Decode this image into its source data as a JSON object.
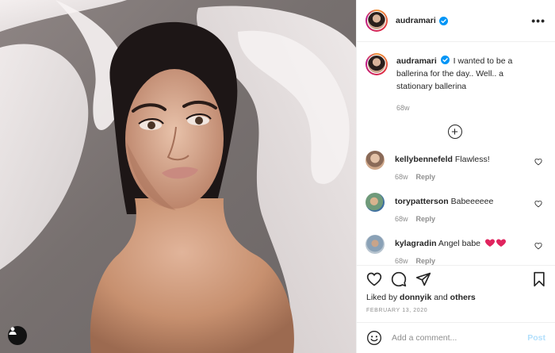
{
  "post": {
    "username": "audramari",
    "verified": true,
    "more_icon": "more-horizontal-icon",
    "caption": {
      "username": "audramari",
      "text": "I wanted to be a ballerina for the day.. Well.. a stationary ballerina",
      "timestamp": "68w"
    },
    "load_more_icon": "plus-circle-icon",
    "comments": [
      {
        "username": "kellybennefeld",
        "text": "Flawless!",
        "timestamp": "68w",
        "reply": "Reply",
        "avatar_color": "#cfa88b"
      },
      {
        "username": "torypatterson",
        "text": "Babeeeeee",
        "timestamp": "68w",
        "reply": "Reply",
        "avatar_color": "#6f9a7a"
      },
      {
        "username": "kylagradin",
        "text": "Angel babe",
        "emoji": "two-hearts",
        "timestamp": "68w",
        "reply": "Reply",
        "avatar_color": "#8aa1b6"
      }
    ],
    "likes": {
      "prefix": "Liked by",
      "user": "donnyik",
      "and": "and",
      "others": "others"
    },
    "date": "FEBRUARY 13, 2020",
    "add_comment": {
      "placeholder": "Add a comment...",
      "post_label": "Post"
    },
    "colors": {
      "accent_blue": "#0095f6",
      "post_disabled": "#b2dffc",
      "text_muted": "#8e8e8e",
      "heart_red": "#ed4956"
    }
  }
}
